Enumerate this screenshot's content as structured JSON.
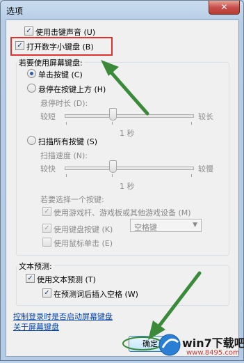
{
  "window": {
    "title": "选项",
    "close_glyph": "✕"
  },
  "options": {
    "sound": {
      "label": "使用击键声音 (U)",
      "checked": true
    },
    "numpad": {
      "label": "打开数字小键盘 (B)",
      "checked": true
    }
  },
  "screen_kb": {
    "legend": "若要使用屏幕键盘:",
    "click_keys": {
      "label": "单击按键 (C)",
      "selected": true
    },
    "hover_keys": {
      "label": "悬停在按键上方 (H)",
      "selected": false
    },
    "hover_duration": {
      "label": "悬停时长 (D):",
      "min_label": "较短",
      "max_label": "较长",
      "value_label": "1 秒"
    },
    "scan_keys": {
      "label": "扫描所有按键 (S)",
      "selected": false
    },
    "scan_speed": {
      "label": "扫描速度 (N):",
      "min_label": "较快",
      "max_label": "较慢",
      "value_label": "1 秒"
    },
    "select_key_label": "若要选择一个按键:",
    "use_joystick": {
      "label": "使用游戏杆、游戏板或其他游戏设备 (M)",
      "checked": true
    },
    "use_kb_key": {
      "label": "使用键盘按键 (K)",
      "checked": true
    },
    "key_select": {
      "value": "空格键"
    },
    "use_mouse": {
      "label": "使用鼠标单击 (E)",
      "checked": false
    }
  },
  "prediction": {
    "legend": "文本预测:",
    "use_prediction": {
      "label": "使用文本预测 (T)",
      "checked": true
    },
    "insert_space": {
      "label": "在预测词后插入空格 (W)",
      "checked": true
    }
  },
  "links": {
    "control_login": "控制登录时是否启动屏幕键盘",
    "about": "关于屏幕键盘"
  },
  "buttons": {
    "ok": "确定"
  },
  "watermark": {
    "brand": "win7下载吧",
    "url": "www.8495.com"
  },
  "colors": {
    "highlight": "#e03030",
    "arrow": "#3a8a3a",
    "link": "#0645ad"
  },
  "icons": {
    "check": "✓",
    "dropdown": "▼",
    "close": "close-icon"
  }
}
